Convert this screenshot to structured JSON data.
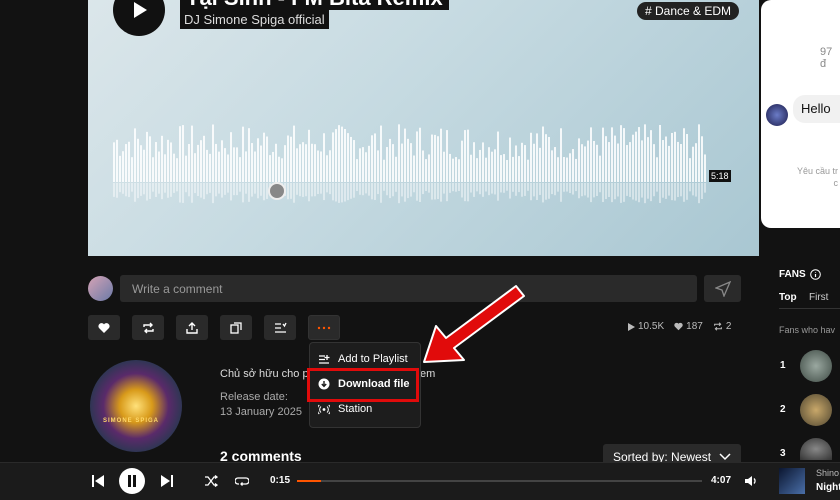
{
  "hero": {
    "track_title": "Tại Sinh - FM Bita Remix",
    "artist": "DJ Simone Spiga official",
    "genre_tag": "# Dance & EDM",
    "duration_badge": "5:18"
  },
  "chat": {
    "count_text": "97 đ",
    "message": "Hello",
    "footer_line1": "Yêu cầu tr",
    "footer_line2": "c"
  },
  "comment": {
    "placeholder": "Write a comment"
  },
  "stats": {
    "plays": "10.5K",
    "likes": "187",
    "reposts": "2"
  },
  "menu": {
    "items": [
      "Add to Playlist",
      "Download file",
      "Station"
    ]
  },
  "track_info": {
    "owner_text_a": "Chủ sở hữu cho p",
    "owner_text_b": "em",
    "release_label": "Release date:",
    "release_date": "13 January 2025",
    "cover_label": "SIMONE SPIGA"
  },
  "comments": {
    "count_label": "2 comments",
    "sort_label": "Sorted by: Newest"
  },
  "fans": {
    "title": "FANS",
    "tabs": [
      "Top",
      "First"
    ],
    "who_text": "Fans who hav",
    "ranks": [
      "1",
      "2",
      "3"
    ]
  },
  "player": {
    "current_time": "0:15",
    "total_time": "4:07",
    "progress": 0.06,
    "now_playing_artist": "Shino",
    "now_playing_title": "Night"
  },
  "colors": {
    "accent": "#ff5500",
    "highlight_red": "#e10b0b"
  }
}
